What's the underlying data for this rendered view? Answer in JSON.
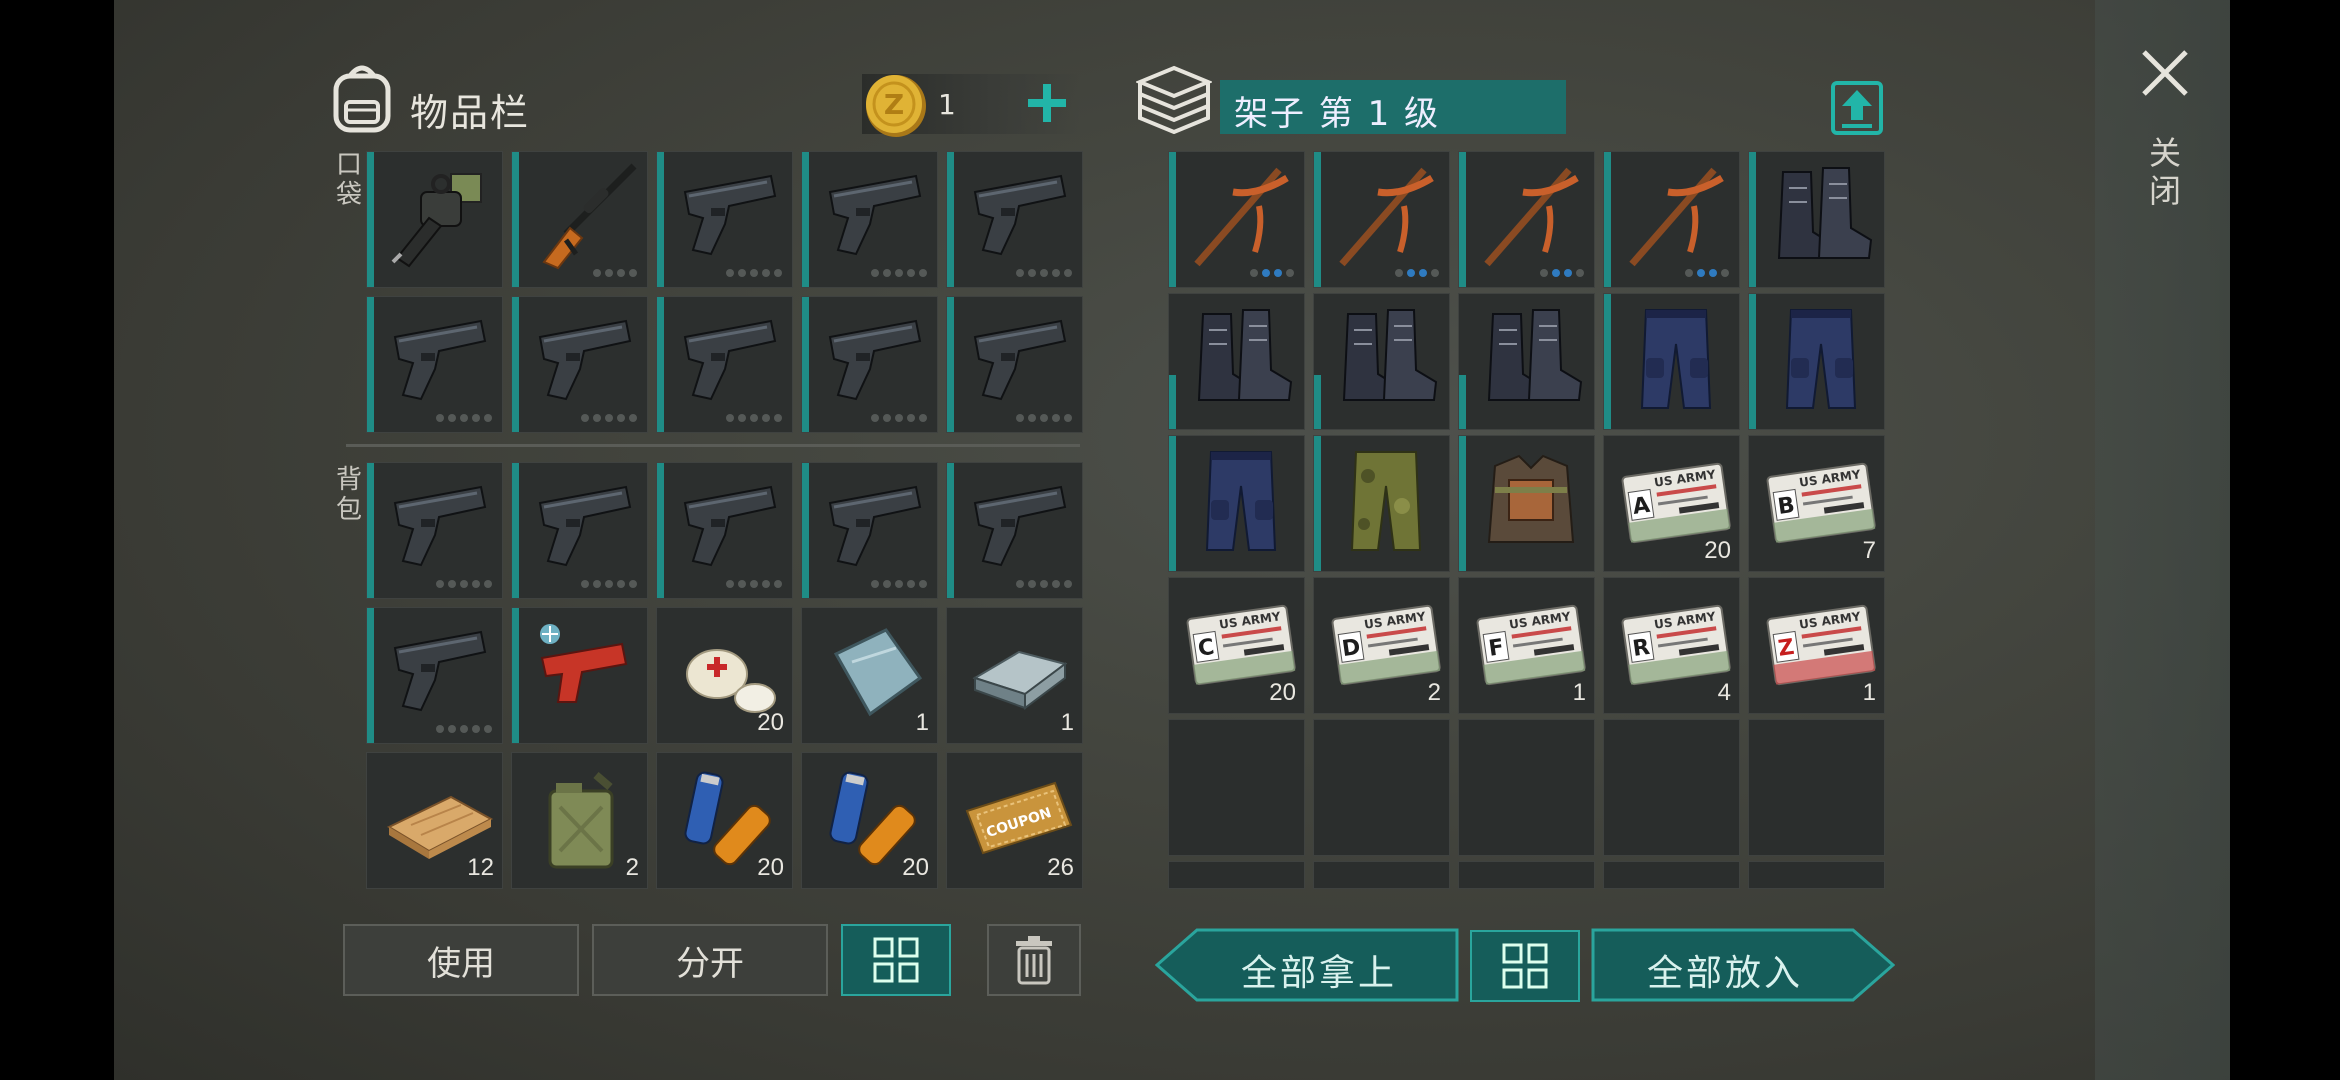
{
  "inventory": {
    "title": "物品栏",
    "coin_count": "1",
    "pocket_label": "口袋",
    "backpack_label": "背包",
    "slots": [
      {
        "item": "chainsaw",
        "count": "",
        "dots": 0
      },
      {
        "item": "sniper-rifle",
        "count": "",
        "dots": 4
      },
      {
        "item": "pistol",
        "count": "",
        "dots": 5
      },
      {
        "item": "pistol",
        "count": "",
        "dots": 5
      },
      {
        "item": "pistol",
        "count": "",
        "dots": 5
      },
      {
        "item": "pistol",
        "count": "",
        "dots": 5
      },
      {
        "item": "pistol",
        "count": "",
        "dots": 5
      },
      {
        "item": "pistol",
        "count": "",
        "dots": 5
      },
      {
        "item": "pistol",
        "count": "",
        "dots": 5
      },
      {
        "item": "pistol",
        "count": "",
        "dots": 5
      },
      {
        "item": "pistol",
        "count": "",
        "dots": 5
      },
      {
        "item": "pistol",
        "count": "",
        "dots": 5
      },
      {
        "item": "pistol",
        "count": "",
        "dots": 5
      },
      {
        "item": "pistol",
        "count": "",
        "dots": 5
      },
      {
        "item": "pistol",
        "count": "",
        "dots": 5
      },
      {
        "item": "pistol",
        "count": "",
        "dots": 5
      },
      {
        "item": "flare-gun",
        "count": "",
        "dots": 0
      },
      {
        "item": "bandage",
        "count": "20",
        "dots": 0
      },
      {
        "item": "metal-sheet",
        "count": "1",
        "dots": 0
      },
      {
        "item": "iron-ingot",
        "count": "1",
        "dots": 0
      },
      {
        "item": "wood-plank",
        "count": "12",
        "dots": 0
      },
      {
        "item": "gas-can",
        "count": "2",
        "dots": 0
      },
      {
        "item": "batteries",
        "count": "20",
        "dots": 0
      },
      {
        "item": "batteries",
        "count": "20",
        "dots": 0
      },
      {
        "item": "coupon",
        "count": "26",
        "dots": 0
      }
    ],
    "buttons": {
      "use": "使用",
      "split": "分开"
    }
  },
  "shelf": {
    "title": "架子 第 1 级",
    "slots": [
      {
        "item": "pickaxe",
        "count": "",
        "dots": 4,
        "active": 2
      },
      {
        "item": "pickaxe",
        "count": "",
        "dots": 4,
        "active": 2
      },
      {
        "item": "pickaxe",
        "count": "",
        "dots": 4,
        "active": 2
      },
      {
        "item": "pickaxe",
        "count": "",
        "dots": 4,
        "active": 2
      },
      {
        "item": "boots",
        "count": "",
        "dots": 0
      },
      {
        "item": "boots",
        "count": "",
        "dots": 0
      },
      {
        "item": "boots",
        "count": "",
        "dots": 0
      },
      {
        "item": "boots",
        "count": "",
        "dots": 0
      },
      {
        "item": "pants-blue",
        "count": "",
        "dots": 0
      },
      {
        "item": "pants-blue",
        "count": "",
        "dots": 0
      },
      {
        "item": "pants-blue",
        "count": "",
        "dots": 0
      },
      {
        "item": "pants-camo",
        "count": "",
        "dots": 0
      },
      {
        "item": "armor-vest",
        "count": "",
        "dots": 0
      },
      {
        "item": "army-card",
        "letter": "A",
        "count": "20",
        "dots": 0
      },
      {
        "item": "army-card",
        "letter": "B",
        "count": "7",
        "dots": 0
      },
      {
        "item": "army-card",
        "letter": "C",
        "count": "20",
        "dots": 0
      },
      {
        "item": "army-card",
        "letter": "D",
        "count": "2",
        "dots": 0
      },
      {
        "item": "army-card",
        "letter": "F",
        "count": "1",
        "dots": 0
      },
      {
        "item": "army-card",
        "letter": "R",
        "count": "4",
        "dots": 0
      },
      {
        "item": "army-card",
        "letter": "Z",
        "count": "1",
        "dots": 0
      }
    ],
    "card_text": "US ARMY",
    "buttons": {
      "take_all": "全部拿上",
      "put_all": "全部放入"
    }
  },
  "close_label": "关闭",
  "coupon_text": "COUPON",
  "colors": {
    "accent": "#1f8c86",
    "teal_button": "#155d5a",
    "coin": "#e0b335"
  }
}
